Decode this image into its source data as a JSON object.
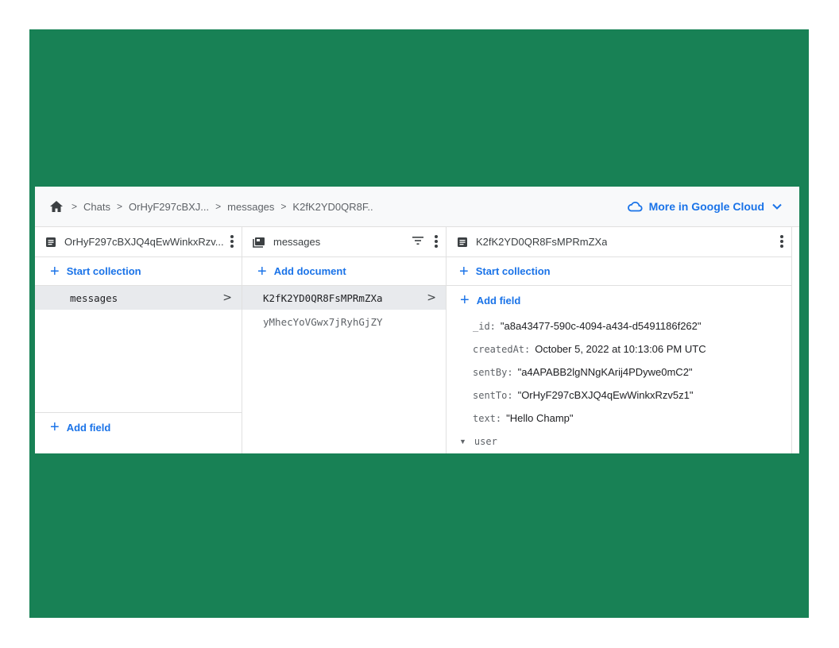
{
  "breadcrumb": {
    "items": [
      "Chats",
      "OrHyF297cBXJ...",
      "messages",
      "K2fK2YD0QR8F.."
    ],
    "separator": ">"
  },
  "cloud_link": {
    "label": "More in Google Cloud"
  },
  "columns": [
    {
      "title": "OrHyF297cBXJQ4qEwWinkxRzv...",
      "action": "Start collection",
      "rows": [
        {
          "label": "messages",
          "arrow": ">"
        }
      ],
      "add_field": "Add field"
    },
    {
      "title": "messages",
      "action": "Add document",
      "rows": [
        {
          "label": "K2fK2YD0QR8FsMPRmZXa",
          "arrow": ">"
        },
        {
          "label": "yMhecYoVGwx7jRyhGjZY"
        }
      ]
    },
    {
      "title": "K2fK2YD0QR8FsMPRmZXa",
      "action": "Start collection",
      "add_field": "Add field",
      "fields": [
        {
          "key": "_id:",
          "value": "\"a8a43477-590c-4094-a434-d5491186f262\""
        },
        {
          "key": "createdAt:",
          "value": "October 5, 2022 at 10:13:06 PM UTC"
        },
        {
          "key": "sentBy:",
          "value": "\"a4APABB2lgNNgKArij4PDywe0mC2\""
        },
        {
          "key": "sentTo:",
          "value": "\"OrHyF297cBXJQ4qEwWinkxRzv5z1\""
        },
        {
          "key": "text:",
          "value": "\"Hello Champ\""
        },
        {
          "key": "user"
        }
      ]
    }
  ],
  "colors": {
    "accent": "#1a73e8",
    "background": "#188155",
    "selected_row": "#e8eaed"
  },
  "icons": [
    "home-icon",
    "chevron-right-icon",
    "cloud-icon",
    "chevron-down-icon",
    "document-icon",
    "collection-icon",
    "filter-icon",
    "more-vert-icon",
    "plus-icon",
    "triangle-down-icon"
  ]
}
